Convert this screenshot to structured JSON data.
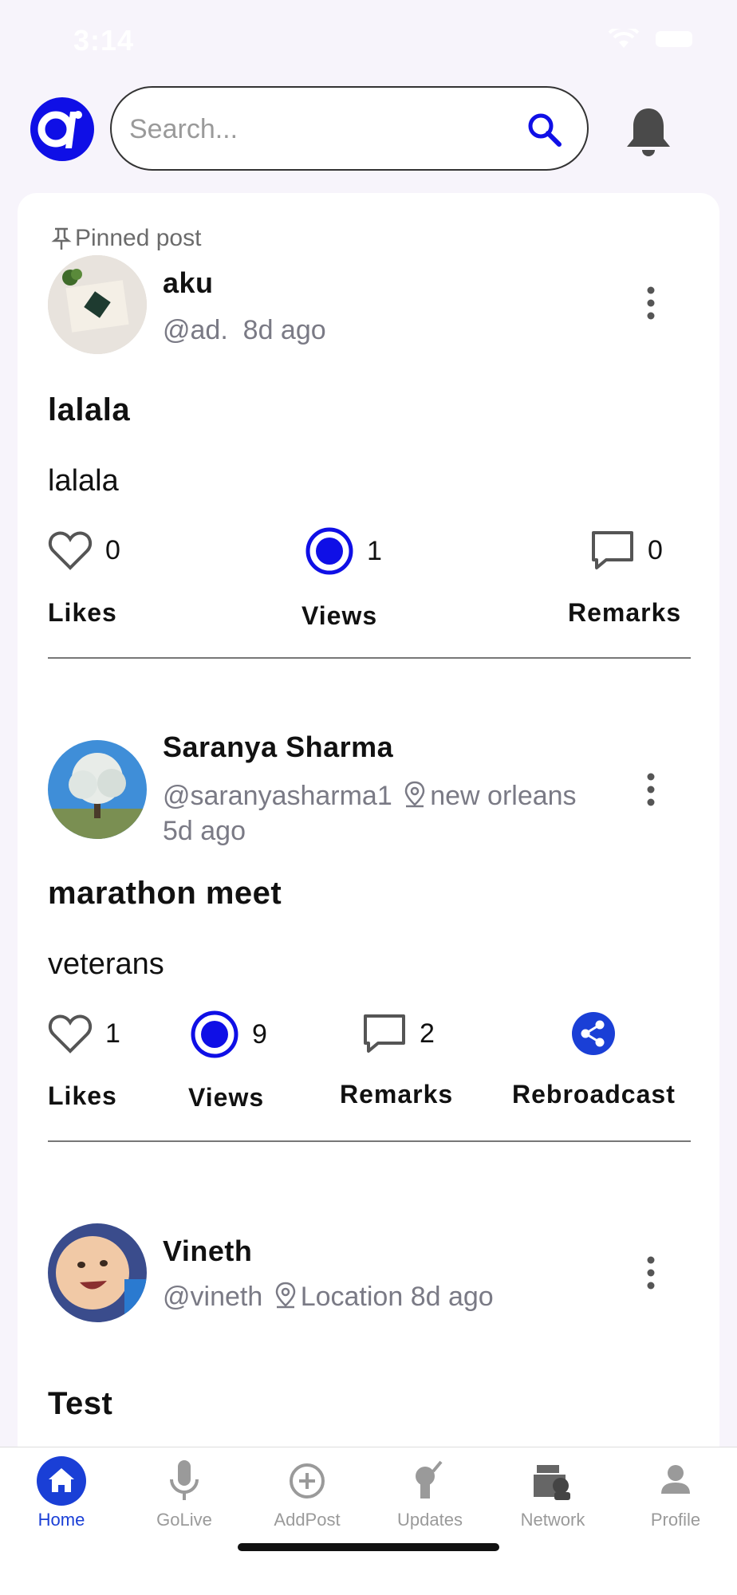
{
  "status_bar": {
    "time": "3:14"
  },
  "header": {
    "search": {
      "placeholder": "Search..."
    }
  },
  "colors": {
    "accent": "#0f0fe6",
    "nav_active": "#1a3fd6",
    "muted": "#7a7a85"
  },
  "feed": {
    "pinned_label": "Pinned post",
    "posts": [
      {
        "name": "aku",
        "meta": "@ad.  8d ago",
        "title": "lalala",
        "body": "lalala",
        "likes_count": "0",
        "likes_label": "Likes",
        "views_count": "1",
        "views_label": "Views",
        "remarks_count": "0",
        "remarks_label": "Remarks"
      },
      {
        "name": "Saranya Sharma",
        "handle": "@saranyasharma1",
        "location": "new orleans",
        "time": "5d ago",
        "title": "marathon meet",
        "body": "veterans",
        "likes_count": "1",
        "likes_label": "Likes",
        "views_count": "9",
        "views_label": "Views",
        "remarks_count": "2",
        "remarks_label": "Remarks",
        "rebroadcast_label": "Rebroadcast"
      },
      {
        "name": "Vineth",
        "handle": "@vineth",
        "location": "Location",
        "time": "8d ago",
        "title": "Test"
      }
    ]
  },
  "nav": {
    "items": [
      {
        "label": "Home",
        "icon": "home-icon"
      },
      {
        "label": "GoLive",
        "icon": "microphone-icon"
      },
      {
        "label": "AddPost",
        "icon": "add-circle-icon"
      },
      {
        "label": "Updates",
        "icon": "updates-icon"
      },
      {
        "label": "Network",
        "icon": "network-icon"
      },
      {
        "label": "Profile",
        "icon": "profile-icon"
      }
    ]
  }
}
